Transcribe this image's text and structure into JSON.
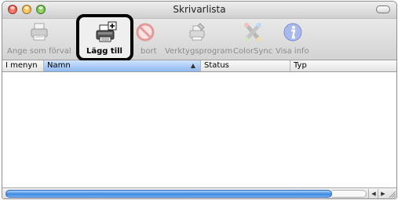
{
  "window": {
    "title": "Skrivarlista"
  },
  "toolbar": {
    "items": [
      {
        "label": "Ange som förval",
        "icon": "printer-default-icon"
      },
      {
        "label": "Lägg till",
        "icon": "add-printer-icon"
      },
      {
        "label": "bort",
        "icon": "delete-icon"
      },
      {
        "label": "Verktygsprogram",
        "icon": "utility-icon"
      },
      {
        "label": "ColorSync",
        "icon": "colorsync-icon"
      },
      {
        "label": "Visa info",
        "icon": "info-icon"
      }
    ]
  },
  "table": {
    "columns": [
      "I menyn",
      "Namn",
      "Status",
      "Typ"
    ],
    "sort_indicator": "▲"
  },
  "scrollbar": {
    "left_arrow": "◀",
    "right_arrow": "▶"
  },
  "colors": {
    "selected_column": "#8fb8f0",
    "scroll_thumb": "#3a86e0",
    "highlight_border": "#000000"
  }
}
